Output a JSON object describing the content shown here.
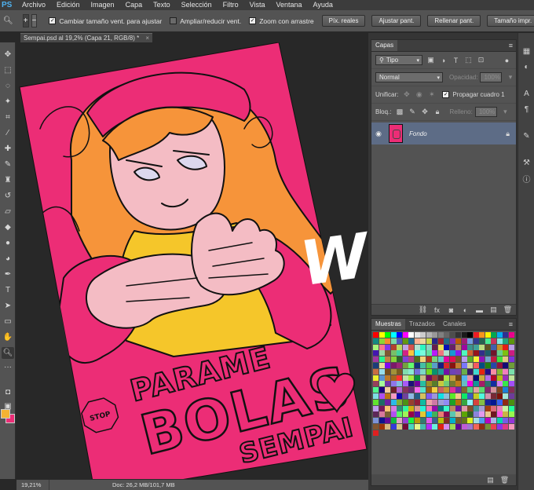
{
  "app": {
    "logo": "PS"
  },
  "menu": [
    "Archivo",
    "Edición",
    "Imagen",
    "Capa",
    "Texto",
    "Selección",
    "Filtro",
    "Vista",
    "Ventana",
    "Ayuda"
  ],
  "options": {
    "resize_windows": "Cambiar tamaño vent. para ajustar",
    "zoom_all": "Ampliar/reducir vent.",
    "scrubby_zoom": "Zoom con arrastre",
    "actual_pixels": "Píx. reales",
    "fit_screen": "Ajustar pant.",
    "fill_screen": "Rellenar pant.",
    "print_size": "Tamaño impr."
  },
  "document": {
    "tab_title": "Sempai.psd al 19,2% (Capa 21, RGB/8) *"
  },
  "status": {
    "zoom": "19,21%",
    "doc_size": "Doc: 26,2 MB/101,7 MB"
  },
  "layers_panel": {
    "tab": "Capas",
    "filter_kind": "Tipo",
    "blend_mode": "Normal",
    "opacity_label": "Opacidad:",
    "opacity_value": "100%",
    "unify_label": "Unificar:",
    "propagate_label": "Propagar cuadro 1",
    "lock_label": "Bloq.:",
    "fill_label": "Relleno:",
    "fill_value": "100%",
    "layer_name": "Fondo"
  },
  "swatches_panel": {
    "tabs": [
      "Muestras",
      "Trazados",
      "Canales"
    ]
  },
  "artwork": {
    "text_lines": [
      "PARAME",
      "BOLAS",
      "SEMPAI"
    ],
    "stop_sign": "STOP",
    "overlay": "WIP"
  },
  "colors": {
    "foreground": "#f5b333",
    "background": "#ec2d76",
    "artwork_pink": "#ec2d76",
    "hair_orange": "#f6943a",
    "skin": "#f4bcc4",
    "selected_layer": "#5d6c86"
  }
}
